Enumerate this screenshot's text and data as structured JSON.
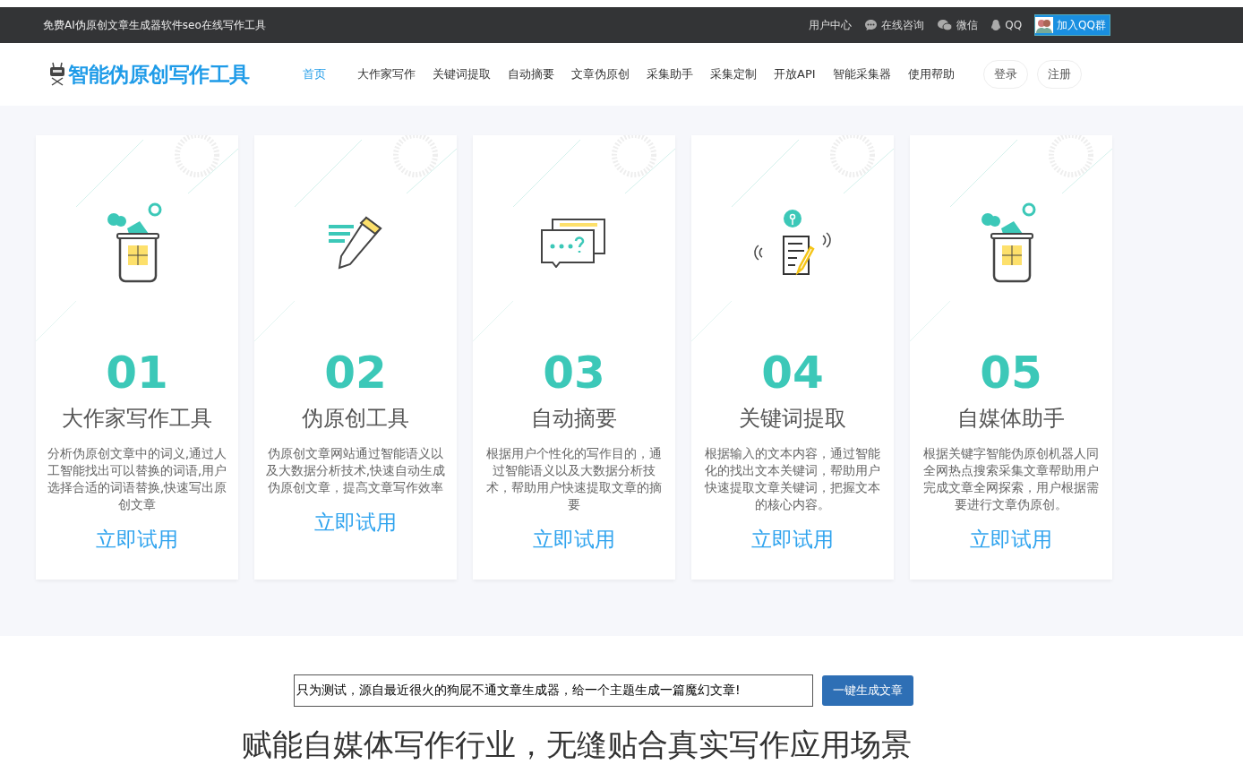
{
  "topbar": {
    "tagline": "免费AI伪原创文章生成器软件seo在线写作工具",
    "links": [
      {
        "kind": "text",
        "label": "用户中心"
      },
      {
        "kind": "chat",
        "label": "在线咨询"
      },
      {
        "kind": "wechat",
        "label": "微信"
      },
      {
        "kind": "qq",
        "label": "QQ"
      }
    ],
    "qq_group": "加入QQ群"
  },
  "header": {
    "logo": "智能伪原创写作工具",
    "nav": [
      {
        "label": "首页",
        "selected": true
      },
      {
        "label": "大作家写作",
        "selected": false
      },
      {
        "label": "关键词提取",
        "selected": false
      },
      {
        "label": "自动摘要",
        "selected": false
      },
      {
        "label": "文章伪原创",
        "selected": false
      },
      {
        "label": "采集助手",
        "selected": false
      },
      {
        "label": "采集定制",
        "selected": false
      },
      {
        "label": "开放API",
        "selected": false
      },
      {
        "label": "智能采集器",
        "selected": false
      },
      {
        "label": "使用帮助",
        "selected": false
      }
    ],
    "buttons": [
      "登录",
      "注册"
    ]
  },
  "cards": [
    {
      "kind": "bin",
      "number": "01",
      "title": "大作家写作工具",
      "text": "分析伪原创文章中的词义,通过人工智能找出可以替换的词语,用户选择合适的词语替换,快速写出原创文章",
      "link": "立即试用"
    },
    {
      "kind": "pencil",
      "number": "02",
      "title": "伪原创工具",
      "text": "伪原创文章网站通过智能语义以及大数据分析技术,快速自动生成伪原创文章，提高文章写作效率",
      "link": "立即试用"
    },
    {
      "kind": "chat",
      "number": "03",
      "title": "自动摘要",
      "text": "根据用户个性化的写作目的，通过智能语义以及大数据分析技术，帮助用户快速提取文章的摘要",
      "link": "立即试用"
    },
    {
      "kind": "doc",
      "number": "04",
      "title": "关键词提取",
      "text": "根据输入的文本内容，通过智能化的找出文本关键词，帮助用户快速提取文章关键词，把握文本的核心内容。",
      "link": "立即试用"
    },
    {
      "kind": "bin",
      "number": "05",
      "title": "自媒体助手",
      "text": "根据关键字智能伪原创机器人同全网热点搜索采集文章帮助用户完成文章全网探索，用户根据需要进行文章伪原创。",
      "link": "立即试用"
    }
  ],
  "generator": {
    "value": "只为测试，源自最近很火的狗屁不通文章生成器，给一个主题生成一篇魔幻文章!",
    "button": "一键生成文章"
  },
  "headline": "赋能自媒体写作行业，无缝贴合真实写作应用场景"
}
